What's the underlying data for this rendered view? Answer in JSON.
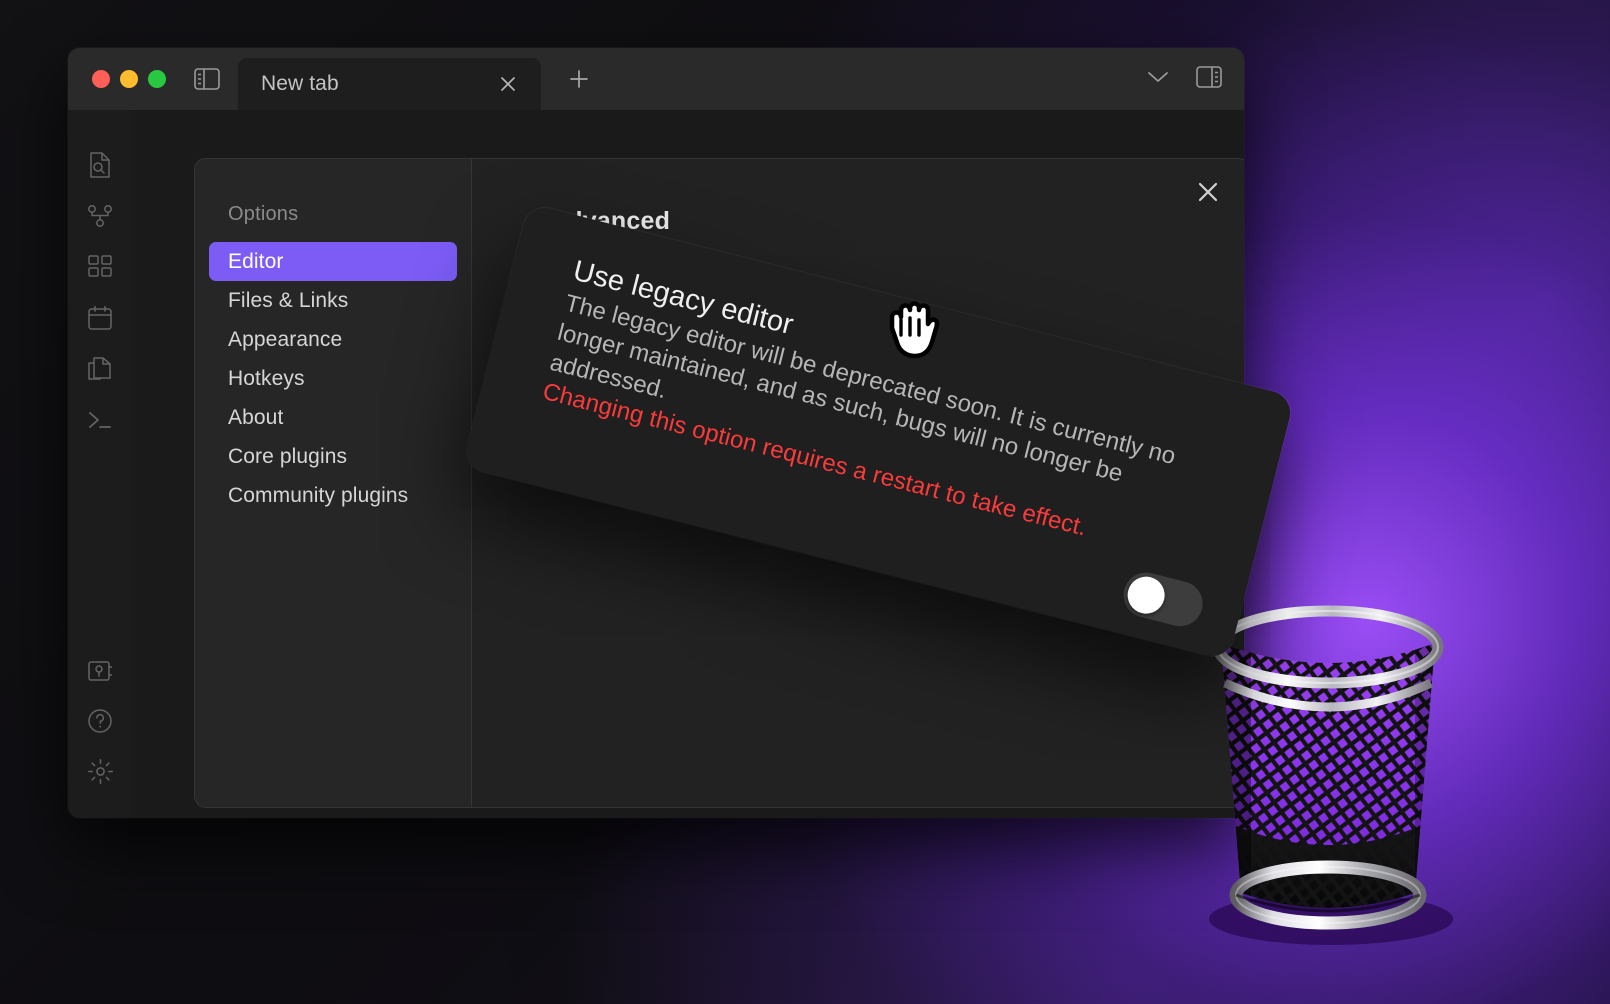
{
  "window": {
    "traffic_lights": [
      {
        "name": "close",
        "color": "#ff5f57"
      },
      {
        "name": "minimize",
        "color": "#febc2e"
      },
      {
        "name": "zoom",
        "color": "#28c840"
      }
    ],
    "left_sidebar_toggle_icon": "left-sidebar-toggle-icon",
    "right_sidebar_toggle_icon": "right-sidebar-toggle-icon",
    "tab_list_chevron_icon": "chevron-down-icon",
    "tab": {
      "label": "New tab",
      "close_icon": "close-icon"
    },
    "new_tab_icon": "plus-icon"
  },
  "rail": {
    "top_items": [
      {
        "icon": "file-search-icon",
        "label": "Quick switcher"
      },
      {
        "icon": "graph-view-icon",
        "label": "Graph view"
      },
      {
        "icon": "canvas-grid-icon",
        "label": "Canvas"
      },
      {
        "icon": "calendar-icon",
        "label": "Daily note"
      },
      {
        "icon": "copy-files-icon",
        "label": "Files"
      },
      {
        "icon": "terminal-icon",
        "label": "Terminal"
      }
    ],
    "bottom_items": [
      {
        "icon": "vault-icon",
        "label": "Vault"
      },
      {
        "icon": "help-circle-icon",
        "label": "Help"
      },
      {
        "icon": "gear-icon",
        "label": "Settings"
      }
    ]
  },
  "settings": {
    "nav_title": "Options",
    "nav_items": [
      {
        "label": "Editor",
        "active": true
      },
      {
        "label": "Files & Links",
        "active": false
      },
      {
        "label": "Appearance",
        "active": false
      },
      {
        "label": "Hotkeys",
        "active": false
      },
      {
        "label": "About",
        "active": false
      },
      {
        "label": "Core plugins",
        "active": false
      },
      {
        "label": "Community plugins",
        "active": false
      }
    ],
    "heading": "Advanced",
    "close_icon": "close-icon",
    "more_options_icon": "more-options-icon"
  },
  "dragged_setting": {
    "title": "Use legacy editor",
    "description": "The legacy editor will be deprecated soon. It is currently no longer maintained, and as such, bugs will no longer be addressed.",
    "warning": "Changing this option requires a restart to take effect.",
    "toggle_state": "off",
    "toggle_name": "use-legacy-editor-toggle"
  },
  "cursor": {
    "icon": "grab-hand-cursor"
  },
  "desktop": {
    "trash_icon": "trash-can-icon"
  },
  "colors": {
    "accent_purple": "#7c5cf5",
    "warning_red": "#fb3b3b",
    "window_bg": "#1e1e1e",
    "modal_bg": "#222222",
    "nav_bg": "#262626",
    "card_bg": "#1f1f1f",
    "toggle_track": "#3d3d3d",
    "toggle_knob": "#ffffff",
    "desktop_glow": "#a050ff"
  }
}
